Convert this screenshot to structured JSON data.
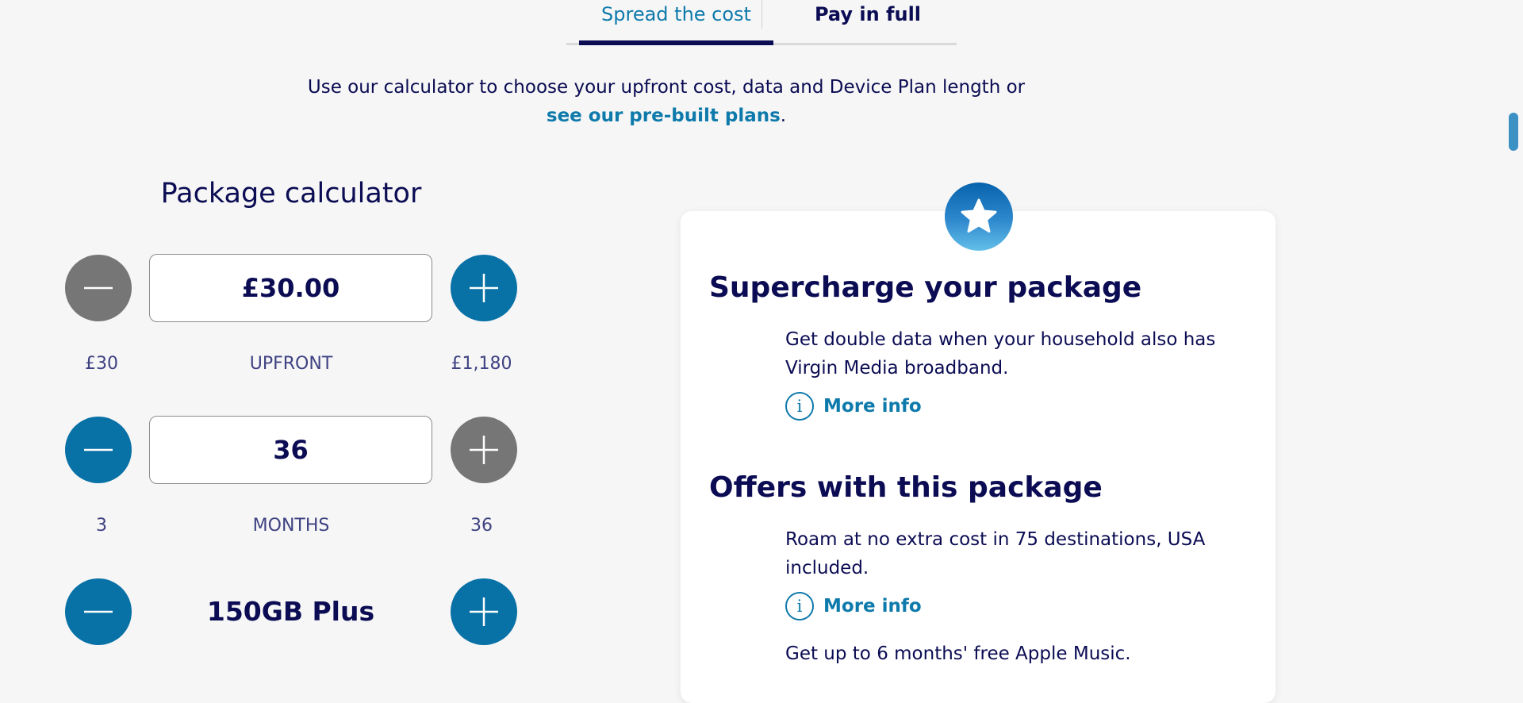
{
  "tabs": {
    "spread": "Spread the cost",
    "full": "Pay in full"
  },
  "intro": {
    "text": "Use our calculator to choose your upfront cost, data and Device Plan length or",
    "link": "see our pre-built plans",
    "end": "."
  },
  "calculator": {
    "title": "Package calculator",
    "upfront": {
      "value": "£30.00",
      "min": "£30",
      "label": "UPFRONT",
      "max": "£1,180"
    },
    "months": {
      "value": "36",
      "min": "3",
      "label": "MONTHS",
      "max": "36"
    },
    "data": {
      "value": "150GB Plus"
    }
  },
  "card": {
    "supercharge_title": "Supercharge your package",
    "supercharge_text": "Get double data when your household also has Virgin Media broadband.",
    "more_info_1": "More info",
    "offers_title": "Offers with this package",
    "offer_1": "Roam at no extra cost in 75 destinations, USA included.",
    "more_info_2": "More info",
    "offer_2": "Get up to 6 months' free Apple Music.",
    "info_glyph": "i"
  },
  "colors": {
    "primary_blue": "#0871a6",
    "navy": "#0b0c53",
    "disabled_grey": "#767676",
    "link": "#0e7aab"
  }
}
